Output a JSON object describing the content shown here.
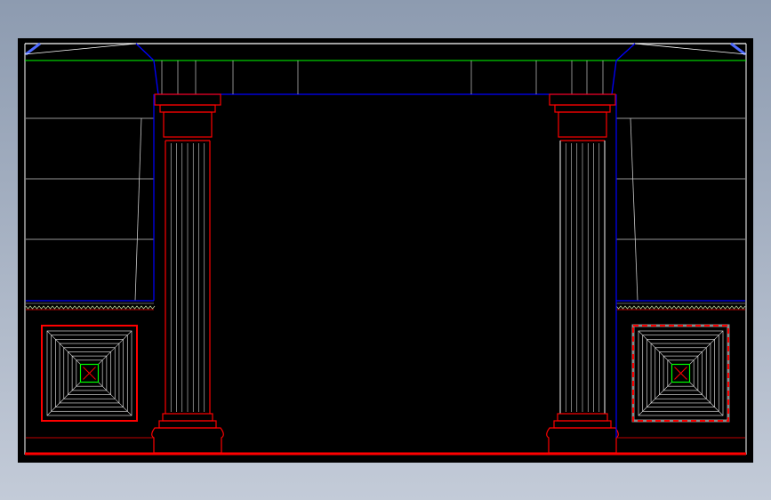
{
  "colors": {
    "background": "#000000",
    "frame": "#ffffff",
    "lines": "#c8c8c8",
    "red": "#ff0000",
    "blue": "#0000ff",
    "green": "#00ff00",
    "panel_gray": "#8a8a8a",
    "ground_line": "#ff0000"
  },
  "drawing": {
    "columns": 2,
    "flutes_per_column": 8,
    "recessed_panels": 2,
    "side_shelves_per_bay": 3,
    "panel_nested_squares": 8
  }
}
